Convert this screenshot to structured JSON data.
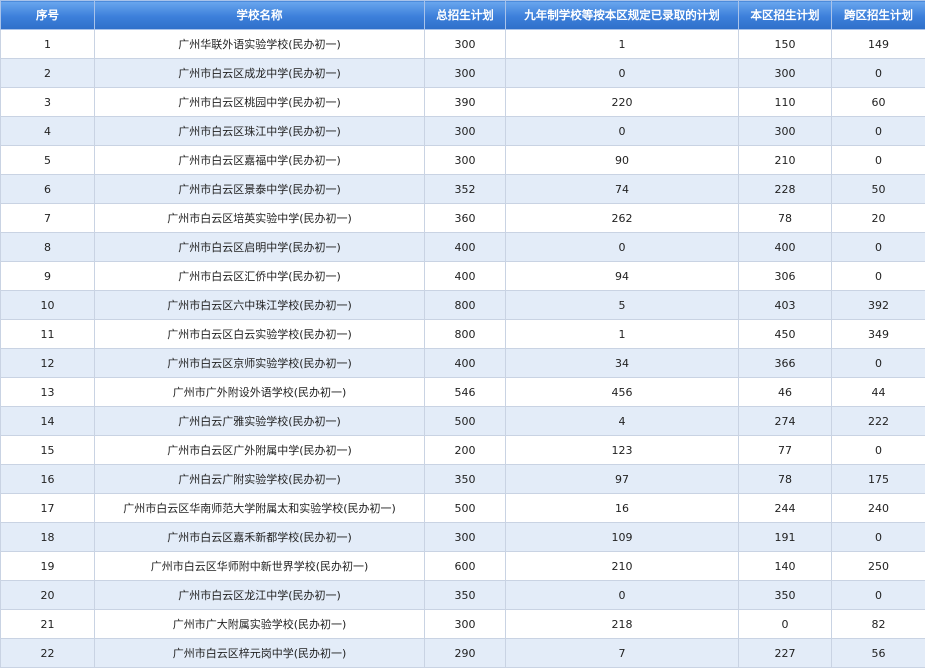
{
  "columns": [
    "序号",
    "学校名称",
    "总招生计划",
    "九年制学校等按本区规定已录取的计划",
    "本区招生计划",
    "跨区招生计划"
  ],
  "rows": [
    [
      "1",
      "广州华联外语实验学校(民办初一)",
      "300",
      "1",
      "150",
      "149"
    ],
    [
      "2",
      "广州市白云区成龙中学(民办初一)",
      "300",
      "0",
      "300",
      "0"
    ],
    [
      "3",
      "广州市白云区桃园中学(民办初一)",
      "390",
      "220",
      "110",
      "60"
    ],
    [
      "4",
      "广州市白云区珠江中学(民办初一)",
      "300",
      "0",
      "300",
      "0"
    ],
    [
      "5",
      "广州市白云区嘉福中学(民办初一)",
      "300",
      "90",
      "210",
      "0"
    ],
    [
      "6",
      "广州市白云区景泰中学(民办初一)",
      "352",
      "74",
      "228",
      "50"
    ],
    [
      "7",
      "广州市白云区培英实验中学(民办初一)",
      "360",
      "262",
      "78",
      "20"
    ],
    [
      "8",
      "广州市白云区启明中学(民办初一)",
      "400",
      "0",
      "400",
      "0"
    ],
    [
      "9",
      "广州市白云区汇侨中学(民办初一)",
      "400",
      "94",
      "306",
      "0"
    ],
    [
      "10",
      "广州市白云区六中珠江学校(民办初一)",
      "800",
      "5",
      "403",
      "392"
    ],
    [
      "11",
      "广州市白云区白云实验学校(民办初一)",
      "800",
      "1",
      "450",
      "349"
    ],
    [
      "12",
      "广州市白云区京师实验学校(民办初一)",
      "400",
      "34",
      "366",
      "0"
    ],
    [
      "13",
      "广州市广外附设外语学校(民办初一)",
      "546",
      "456",
      "46",
      "44"
    ],
    [
      "14",
      "广州白云广雅实验学校(民办初一)",
      "500",
      "4",
      "274",
      "222"
    ],
    [
      "15",
      "广州市白云区广外附属中学(民办初一)",
      "200",
      "123",
      "77",
      "0"
    ],
    [
      "16",
      "广州白云广附实验学校(民办初一)",
      "350",
      "97",
      "78",
      "175"
    ],
    [
      "17",
      "广州市白云区华南师范大学附属太和实验学校(民办初一)",
      "500",
      "16",
      "244",
      "240"
    ],
    [
      "18",
      "广州市白云区嘉禾新都学校(民办初一)",
      "300",
      "109",
      "191",
      "0"
    ],
    [
      "19",
      "广州市白云区华师附中新世界学校(民办初一)",
      "600",
      "210",
      "140",
      "250"
    ],
    [
      "20",
      "广州市白云区龙江中学(民办初一)",
      "350",
      "0",
      "350",
      "0"
    ],
    [
      "21",
      "广州市广大附属实验学校(民办初一)",
      "300",
      "218",
      "0",
      "82"
    ],
    [
      "22",
      "广州市白云区梓元岗中学(民办初一)",
      "290",
      "7",
      "227",
      "56"
    ]
  ]
}
